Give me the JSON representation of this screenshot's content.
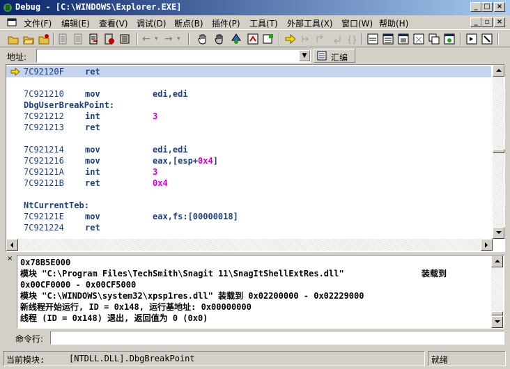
{
  "window": {
    "title": "Debug - [C:\\WINDOWS\\Explorer.EXE]"
  },
  "menu": [
    "文件(F)",
    "编辑(E)",
    "查看(V)",
    "调试(D)",
    "断点(B)",
    "插件(P)",
    "工具(T)",
    "外部工具(X)",
    "窗口(W)",
    "帮助(H)"
  ],
  "address": {
    "label": "地址:",
    "value": "",
    "tab_label": "汇编"
  },
  "disasm": {
    "lines": [
      {
        "type": "code",
        "addr": "7C92120F",
        "mn": "ret",
        "op": "",
        "current": true
      },
      {
        "type": "blank"
      },
      {
        "type": "code",
        "addr": "7C921210",
        "mn": "mov",
        "op": "edi,edi"
      },
      {
        "type": "label",
        "text": "DbgUserBreakPoint:"
      },
      {
        "type": "code",
        "addr": "7C921212",
        "mn": "int",
        "op": "3",
        "opc": "#d000d0"
      },
      {
        "type": "code",
        "addr": "7C921213",
        "mn": "ret",
        "op": ""
      },
      {
        "type": "blank"
      },
      {
        "type": "code",
        "addr": "7C921214",
        "mn": "mov",
        "op": "edi,edi"
      },
      {
        "type": "code",
        "addr": "7C921216",
        "mn": "mov",
        "op": "eax,[esp+0x4]",
        "op_parts": [
          {
            "t": "eax,[esp+"
          },
          {
            "t": "0x4",
            "c": "#d000d0"
          },
          {
            "t": "]"
          }
        ]
      },
      {
        "type": "code",
        "addr": "7C92121A",
        "mn": "int",
        "op": "3",
        "opc": "#d000d0"
      },
      {
        "type": "code",
        "addr": "7C92121B",
        "mn": "ret",
        "op": "0x4",
        "opc": "#d000d0"
      },
      {
        "type": "blank"
      },
      {
        "type": "label",
        "text": "NtCurrentTeb:"
      },
      {
        "type": "code",
        "addr": "7C92121E",
        "mn": "mov",
        "op": "eax,fs:[00000018]"
      },
      {
        "type": "code",
        "addr": "7C921224",
        "mn": "ret",
        "op": ""
      }
    ]
  },
  "log": {
    "lines": [
      {
        "text": "0x78B5E000"
      },
      {
        "text": "模块 \"C:\\Program Files\\TechSmith\\Snagit 11\\SnagItShellExtRes.dll\"",
        "right": "装载到"
      },
      {
        "text": "0x00CF0000 - 0x00CF5000"
      },
      {
        "text": "模块 \"C:\\WINDOWS\\system32\\xpsp1res.dll\" 装载到 0x02200000 - 0x02229000"
      },
      {
        "text": "新线程开始运行, ID = 0x148, 运行基地址: 0x00000000"
      },
      {
        "text": "线程 (ID = 0x148) 退出, 返回值为 0 (0x0)"
      }
    ]
  },
  "command": {
    "label": "命令行:",
    "value": ""
  },
  "status": {
    "module_label": "当前模块:",
    "module_value": "[NTDLL.DLL].DbgBreakPoint",
    "state": "就绪"
  }
}
